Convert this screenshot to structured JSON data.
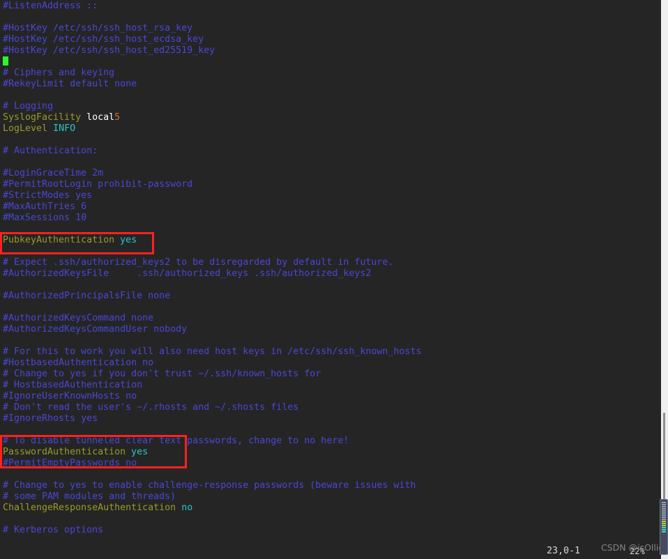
{
  "app": {
    "kind": "terminal-text-editor",
    "editor": "vim",
    "file_kind": "sshd_config"
  },
  "theme": {
    "background": "#252525",
    "comment": "#4a47d6",
    "keyword": "#9a9a29",
    "string": "#ffffff",
    "number": "#cc7832",
    "constant": "#2ec4c4",
    "cursor": "#2cf52c",
    "annotation": "#ff2020",
    "panel": "#efefef",
    "status_text": "#d8d8d8"
  },
  "buffer": {
    "lines": [
      {
        "text": "#ListenAddress ::",
        "tokens": [
          {
            "t": "#ListenAddress ::",
            "c": "c-comment"
          }
        ]
      },
      {
        "text": "",
        "tokens": []
      },
      {
        "text": "#HostKey /etc/ssh/ssh_host_rsa_key",
        "tokens": [
          {
            "t": "#HostKey /etc/ssh/ssh_host_rsa_key",
            "c": "c-comment"
          }
        ]
      },
      {
        "text": "#HostKey /etc/ssh/ssh_host_ecdsa_key",
        "tokens": [
          {
            "t": "#HostKey /etc/ssh/ssh_host_ecdsa_key",
            "c": "c-comment"
          }
        ]
      },
      {
        "text": "#HostKey /etc/ssh/ssh_host_ed25519_key",
        "tokens": [
          {
            "t": "#HostKey /etc/ssh/ssh_host_ed25519_key",
            "c": "c-comment"
          }
        ]
      },
      {
        "text": "",
        "tokens": [],
        "cursor": true
      },
      {
        "text": "# Ciphers and keying",
        "tokens": [
          {
            "t": "# Ciphers and keying",
            "c": "c-comment"
          }
        ]
      },
      {
        "text": "#RekeyLimit default none",
        "tokens": [
          {
            "t": "#RekeyLimit default none",
            "c": "c-comment"
          }
        ]
      },
      {
        "text": "",
        "tokens": []
      },
      {
        "text": "# Logging",
        "tokens": [
          {
            "t": "# Logging",
            "c": "c-comment"
          }
        ]
      },
      {
        "text": "SyslogFacility local5",
        "tokens": [
          {
            "t": "SyslogFacility ",
            "c": "c-keyword"
          },
          {
            "t": "local",
            "c": "c-string"
          },
          {
            "t": "5",
            "c": "c-number"
          }
        ]
      },
      {
        "text": "LogLevel INFO",
        "tokens": [
          {
            "t": "LogLevel ",
            "c": "c-keyword"
          },
          {
            "t": "INFO",
            "c": "c-const"
          }
        ]
      },
      {
        "text": "",
        "tokens": []
      },
      {
        "text": "# Authentication:",
        "tokens": [
          {
            "t": "# Authentication:",
            "c": "c-comment"
          }
        ]
      },
      {
        "text": "",
        "tokens": []
      },
      {
        "text": "#LoginGraceTime 2m",
        "tokens": [
          {
            "t": "#LoginGraceTime 2m",
            "c": "c-comment"
          }
        ]
      },
      {
        "text": "#PermitRootLogin prohibit-password",
        "tokens": [
          {
            "t": "#PermitRootLogin prohibit-password",
            "c": "c-comment"
          }
        ]
      },
      {
        "text": "#StrictModes yes",
        "tokens": [
          {
            "t": "#StrictModes yes",
            "c": "c-comment"
          }
        ]
      },
      {
        "text": "#MaxAuthTries 6",
        "tokens": [
          {
            "t": "#MaxAuthTries 6",
            "c": "c-comment"
          }
        ]
      },
      {
        "text": "#MaxSessions 10",
        "tokens": [
          {
            "t": "#MaxSessions 10",
            "c": "c-comment"
          }
        ]
      },
      {
        "text": "",
        "tokens": []
      },
      {
        "text": "PubkeyAuthentication yes",
        "tokens": [
          {
            "t": "PubkeyAuthentication ",
            "c": "c-keyword"
          },
          {
            "t": "yes",
            "c": "c-const"
          }
        ]
      },
      {
        "text": "",
        "tokens": []
      },
      {
        "text": "# Expect .ssh/authorized_keys2 to be disregarded by default in future.",
        "tokens": [
          {
            "t": "# Expect .ssh/authorized_keys2 to be disregarded by default in future.",
            "c": "c-comment"
          }
        ]
      },
      {
        "text": "#AuthorizedKeysFile     .ssh/authorized_keys .ssh/authorized_keys2",
        "tokens": [
          {
            "t": "#AuthorizedKeysFile     .ssh/authorized_keys .ssh/authorized_keys2",
            "c": "c-comment"
          }
        ]
      },
      {
        "text": "",
        "tokens": []
      },
      {
        "text": "#AuthorizedPrincipalsFile none",
        "tokens": [
          {
            "t": "#AuthorizedPrincipalsFile none",
            "c": "c-comment"
          }
        ]
      },
      {
        "text": "",
        "tokens": []
      },
      {
        "text": "#AuthorizedKeysCommand none",
        "tokens": [
          {
            "t": "#AuthorizedKeysCommand none",
            "c": "c-comment"
          }
        ]
      },
      {
        "text": "#AuthorizedKeysCommandUser nobody",
        "tokens": [
          {
            "t": "#AuthorizedKeysCommandUser nobody",
            "c": "c-comment"
          }
        ]
      },
      {
        "text": "",
        "tokens": []
      },
      {
        "text": "# For this to work you will also need host keys in /etc/ssh/ssh_known_hosts",
        "tokens": [
          {
            "t": "# For this to work you will also need host keys in /etc/ssh/ssh_known_hosts",
            "c": "c-comment"
          }
        ]
      },
      {
        "text": "#HostbasedAuthentication no",
        "tokens": [
          {
            "t": "#HostbasedAuthentication no",
            "c": "c-comment"
          }
        ]
      },
      {
        "text": "# Change to yes if you don't trust ~/.ssh/known_hosts for",
        "tokens": [
          {
            "t": "# Change to yes if you don't trust ~/.ssh/known_hosts for",
            "c": "c-comment"
          }
        ]
      },
      {
        "text": "# HostbasedAuthentication",
        "tokens": [
          {
            "t": "# HostbasedAuthentication",
            "c": "c-comment"
          }
        ]
      },
      {
        "text": "#IgnoreUserKnownHosts no",
        "tokens": [
          {
            "t": "#IgnoreUserKnownHosts no",
            "c": "c-comment"
          }
        ]
      },
      {
        "text": "# Don't read the user's ~/.rhosts and ~/.shosts files",
        "tokens": [
          {
            "t": "# Don't read the user's ~/.rhosts and ~/.shosts files",
            "c": "c-comment"
          }
        ]
      },
      {
        "text": "#IgnoreRhosts yes",
        "tokens": [
          {
            "t": "#IgnoreRhosts yes",
            "c": "c-comment"
          }
        ]
      },
      {
        "text": "",
        "tokens": []
      },
      {
        "text": "# To disable tunneled clear text passwords, change to no here!",
        "tokens": [
          {
            "t": "# To disable tunneled clear text passwords, change to no here!",
            "c": "c-comment"
          }
        ]
      },
      {
        "text": "PasswordAuthentication yes",
        "tokens": [
          {
            "t": "PasswordAuthentication ",
            "c": "c-keyword"
          },
          {
            "t": "yes",
            "c": "c-const"
          }
        ]
      },
      {
        "text": "#PermitEmptyPasswords no",
        "tokens": [
          {
            "t": "#PermitEmptyPasswords no",
            "c": "c-comment"
          }
        ]
      },
      {
        "text": "",
        "tokens": []
      },
      {
        "text": "# Change to yes to enable challenge-response passwords (beware issues with",
        "tokens": [
          {
            "t": "# Change to yes to enable challenge-response passwords (beware issues with",
            "c": "c-comment"
          }
        ]
      },
      {
        "text": "# some PAM modules and threads)",
        "tokens": [
          {
            "t": "# some PAM modules and threads)",
            "c": "c-comment"
          }
        ]
      },
      {
        "text": "ChallengeResponseAuthentication no",
        "tokens": [
          {
            "t": "ChallengeResponseAuthentication ",
            "c": "c-keyword"
          },
          {
            "t": "no",
            "c": "c-const"
          }
        ]
      },
      {
        "text": "",
        "tokens": []
      },
      {
        "text": "# Kerberos options",
        "tokens": [
          {
            "t": "# Kerberos options",
            "c": "c-comment"
          }
        ]
      }
    ]
  },
  "annotations": [
    {
      "id": "annot-pubkey",
      "target": "PubkeyAuthentication yes",
      "color": "#ff2020"
    },
    {
      "id": "annot-password",
      "target": "PasswordAuthentication yes",
      "color": "#ff2020"
    }
  ],
  "statusline": {
    "ruler": "23,0-1",
    "percent": "22%"
  },
  "watermark": {
    "text": "CSDN @isOllie"
  },
  "scrollbar": {
    "thumb_stripes": [
      "g",
      "g",
      "g",
      "c",
      "c",
      "c"
    ]
  }
}
